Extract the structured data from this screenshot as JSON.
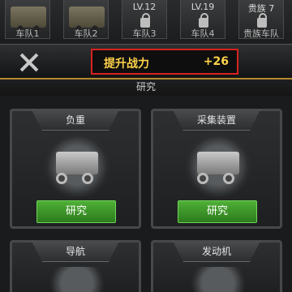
{
  "vehicles": [
    {
      "level": "",
      "name": "车队1",
      "locked": false
    },
    {
      "level": "",
      "name": "车队2",
      "locked": false
    },
    {
      "level": "LV.12",
      "name": "车队3",
      "locked": true
    },
    {
      "level": "LV.19",
      "name": "车队4",
      "locked": true
    },
    {
      "level": "贵族 7",
      "name": "贵族车队",
      "locked": true
    }
  ],
  "header": {
    "boost_label": "提升战力",
    "boost_value": "+26",
    "section_title": "研究"
  },
  "cards": [
    {
      "title": "负重",
      "button": "研究"
    },
    {
      "title": "采集装置",
      "button": "研究"
    },
    {
      "title": "导航",
      "button": ""
    },
    {
      "title": "发动机",
      "button": ""
    }
  ],
  "colors": {
    "highlight_border": "#d8221e",
    "boost_text": "#ffd24a",
    "button_green": "#3f9a2a"
  }
}
